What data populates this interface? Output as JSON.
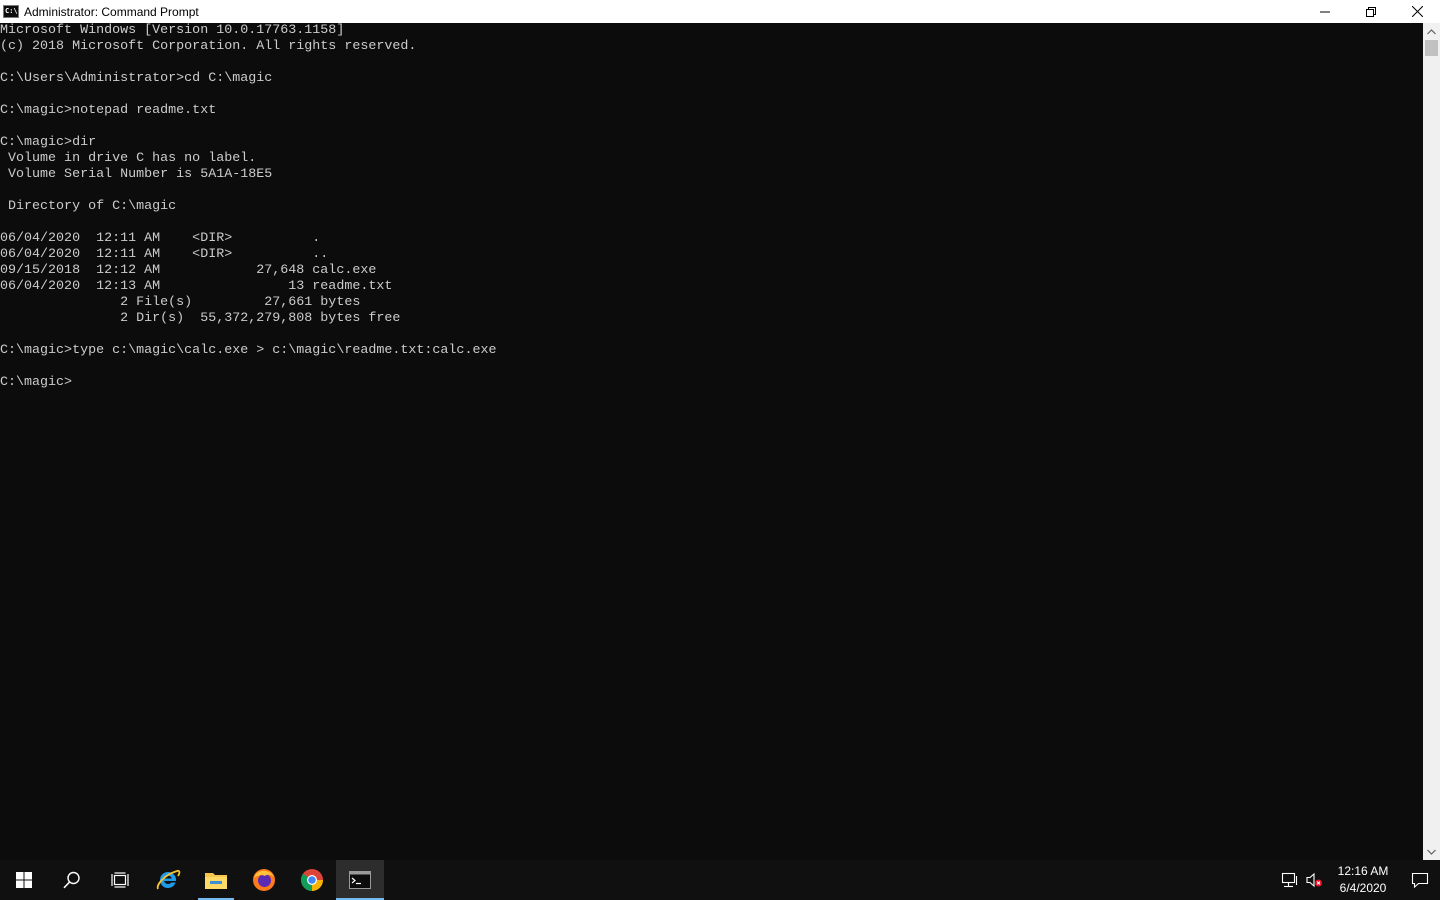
{
  "window": {
    "title": "Administrator: Command Prompt",
    "icon_label": "C:\\"
  },
  "console": {
    "text_color": "#cccccc",
    "background": "#0c0c0c",
    "lines": [
      "Microsoft Windows [Version 10.0.17763.1158]",
      "(c) 2018 Microsoft Corporation. All rights reserved.",
      "",
      "C:\\Users\\Administrator>cd C:\\magic",
      "",
      "C:\\magic>notepad readme.txt",
      "",
      "C:\\magic>dir",
      " Volume in drive C has no label.",
      " Volume Serial Number is 5A1A-18E5",
      "",
      " Directory of C:\\magic",
      "",
      "06/04/2020  12:11 AM    <DIR>          .",
      "06/04/2020  12:11 AM    <DIR>          ..",
      "09/15/2018  12:12 AM            27,648 calc.exe",
      "06/04/2020  12:13 AM                13 readme.txt",
      "               2 File(s)         27,661 bytes",
      "               2 Dir(s)  55,372,279,808 bytes free",
      "",
      "C:\\magic>type c:\\magic\\calc.exe > c:\\magic\\readme.txt:calc.exe",
      "",
      "C:\\magic>"
    ]
  },
  "taskbar": {
    "apps": [
      {
        "name": "start-button",
        "icon": "windows-logo-icon"
      },
      {
        "name": "search-button",
        "icon": "search-icon"
      },
      {
        "name": "task-view-button",
        "icon": "task-view-icon"
      },
      {
        "name": "taskbar-internet-explorer",
        "icon": "internet-explorer-icon"
      },
      {
        "name": "taskbar-file-explorer",
        "icon": "folder-icon"
      },
      {
        "name": "taskbar-firefox",
        "icon": "firefox-icon"
      },
      {
        "name": "taskbar-chrome",
        "icon": "chrome-icon"
      },
      {
        "name": "taskbar-command-prompt",
        "icon": "command-prompt-icon"
      }
    ],
    "accent": "#76b9ed",
    "clock": {
      "time": "12:16 AM",
      "date": "6/4/2020"
    }
  }
}
